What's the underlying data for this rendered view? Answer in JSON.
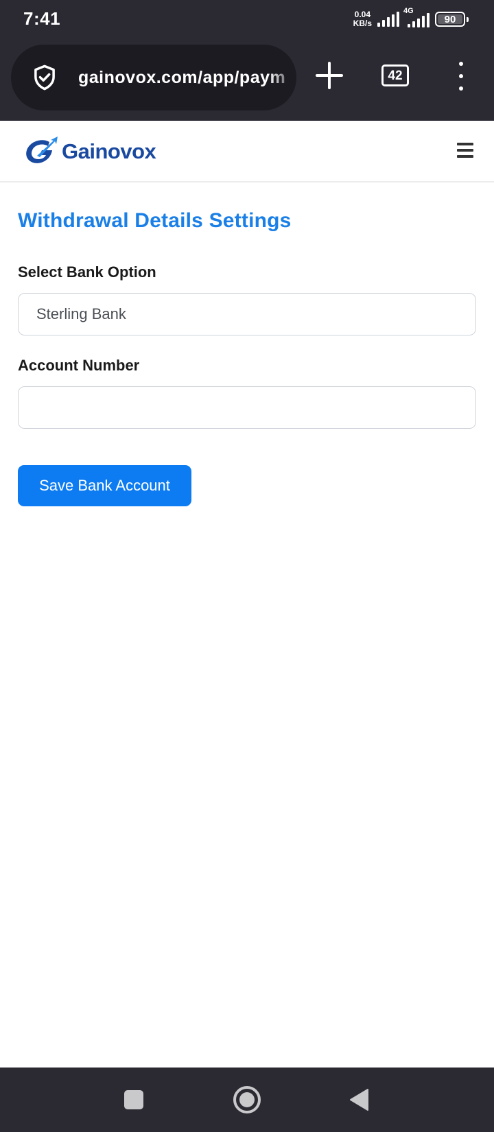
{
  "status_bar": {
    "time": "7:41",
    "net_speed_value": "0.04",
    "net_speed_unit": "KB/s",
    "network_type": "4G",
    "battery_level": "90"
  },
  "browser": {
    "url": "gainovox.com/app/paym",
    "tab_count": "42",
    "icons": [
      "shield-check-icon",
      "plus-icon",
      "tabs-counter",
      "more-vert-icon"
    ]
  },
  "site": {
    "brand": "Gainovox",
    "brand_color": "#1a4aa0",
    "accent_color": "#0d7cf2"
  },
  "form": {
    "title": "Withdrawal Details Settings",
    "bank_label": "Select Bank Option",
    "bank_selected": "Sterling Bank",
    "account_label": "Account Number",
    "account_value": "",
    "save_label": "Save Bank Account"
  },
  "nav_bar": {
    "icons": [
      "recent-apps-icon",
      "home-icon",
      "back-icon"
    ]
  }
}
